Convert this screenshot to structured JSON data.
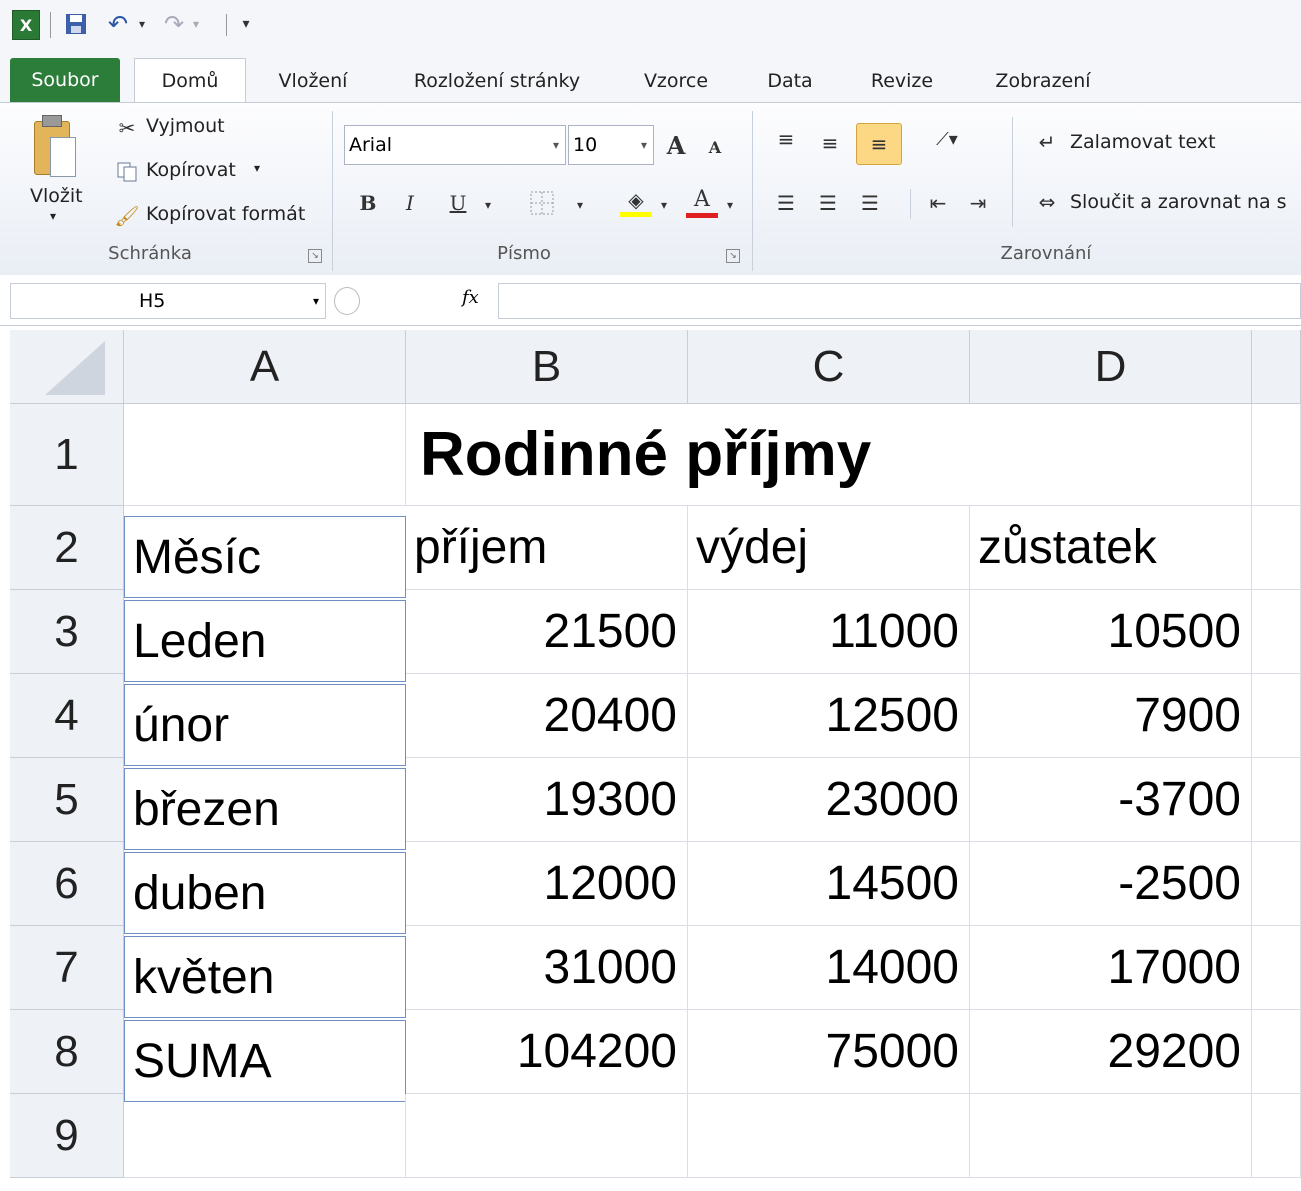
{
  "qat": {
    "undo": "↶",
    "redo": "↷",
    "customize": "▾"
  },
  "tabs": [
    "Soubor",
    "Domů",
    "Vložení",
    "Rozložení stránky",
    "Vzorce",
    "Data",
    "Revize",
    "Zobrazení"
  ],
  "ribbon": {
    "clipboard": {
      "paste": "Vložit",
      "cut": "Vyjmout",
      "copy": "Kopírovat",
      "format_painter": "Kopírovat formát",
      "label": "Schránka"
    },
    "font": {
      "name": "Arial",
      "size": "10",
      "bold": "B",
      "italic": "I",
      "underline": "U",
      "grow": "A",
      "shrink": "A",
      "font_color": "A",
      "label": "Písmo"
    },
    "alignment": {
      "wrap": "Zalamovat text",
      "merge": "Sloučit a zarovnat na s",
      "label": "Zarovnání"
    }
  },
  "formula_bar": {
    "name_box": "H5",
    "fx": "fx",
    "formula": ""
  },
  "columns": [
    "A",
    "B",
    "C",
    "D"
  ],
  "rows": [
    "1",
    "2",
    "3",
    "4",
    "5",
    "6",
    "7",
    "8",
    "9"
  ],
  "sheet": {
    "title": "Rodinné příjmy",
    "headers": [
      "Měsíc",
      "příjem",
      "výdej",
      "zůstatek"
    ],
    "data": [
      [
        "Leden",
        "21500",
        "11000",
        "10500"
      ],
      [
        "únor",
        "20400",
        "12500",
        "7900"
      ],
      [
        "březen",
        "19300",
        "23000",
        "-3700"
      ],
      [
        "duben",
        "12000",
        "14500",
        "-2500"
      ],
      [
        "květen",
        "31000",
        "14000",
        "17000"
      ],
      [
        "SUMA",
        "104200",
        "75000",
        "29200"
      ]
    ]
  }
}
